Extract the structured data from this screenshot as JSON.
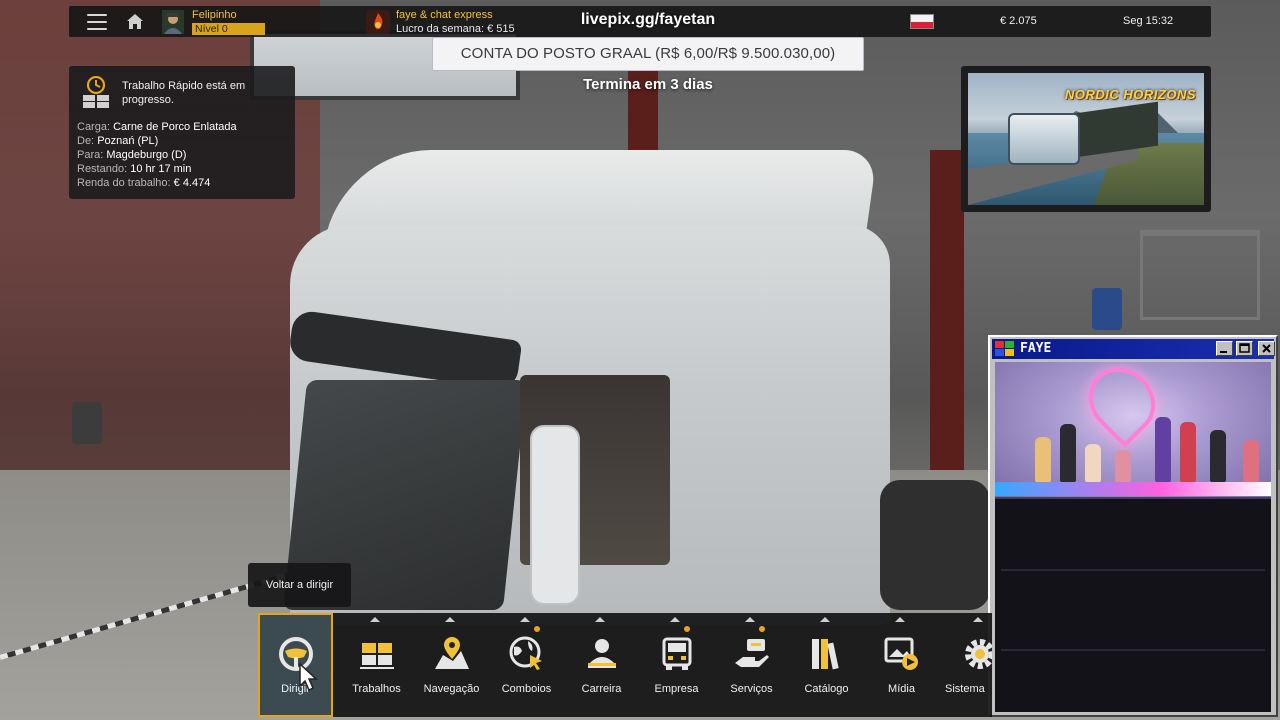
{
  "topbar": {
    "player_name": "Felipinho",
    "level": "Nível 0",
    "company_name": "faye & chat express",
    "weekly_profit": "Lucro da semana: € 515",
    "balance": "€ 2.075",
    "clock": "Seg 15:32",
    "flag_country": "Poland"
  },
  "stream": {
    "url": "livepix.gg/fayetan",
    "goal": "CONTA DO POSTO GRAAL (R$ 6,00/R$ 9.500.030,00)",
    "ends": "Termina em 3 dias"
  },
  "job": {
    "status": "Trabalho Rápido está em progresso.",
    "rows": [
      {
        "key": "Carga:",
        "value": "Carne de Porco Enlatada"
      },
      {
        "key": "De:",
        "value": "Poznań (PL)"
      },
      {
        "key": "Para:",
        "value": "Magdeburgo (D)"
      },
      {
        "key": "Restando:",
        "value": "10 hr 17 min"
      },
      {
        "key": "Renda do trabalho:",
        "value": "€ 4.474"
      }
    ]
  },
  "ad": {
    "title": "NORDIC HORIZONS"
  },
  "webcam": {
    "title": "FAYE"
  },
  "tooltip": "Voltar a dirigir",
  "menu": [
    {
      "label": "Dirigir",
      "icon": "steering-wheel-icon",
      "active": true
    },
    {
      "label": "Trabalhos",
      "icon": "cargo-boxes-icon"
    },
    {
      "label": "Navegação",
      "icon": "map-pin-icon"
    },
    {
      "label": "Comboios",
      "icon": "globe-cursor-icon",
      "notification": true
    },
    {
      "label": "Carreira",
      "icon": "person-icon"
    },
    {
      "label": "Empresa",
      "icon": "truck-front-icon",
      "notification": true
    },
    {
      "label": "Serviços",
      "icon": "service-hand-icon",
      "notification": true
    },
    {
      "label": "Catálogo",
      "icon": "books-icon"
    },
    {
      "label": "Mídia",
      "icon": "media-play-icon"
    },
    {
      "label": "Sistema",
      "icon": "gear-icon"
    }
  ],
  "colors": {
    "accent_gold": "#e5a51a",
    "level_bar": "#d8a41c",
    "title_bar_blue": "#0a1a8a"
  }
}
